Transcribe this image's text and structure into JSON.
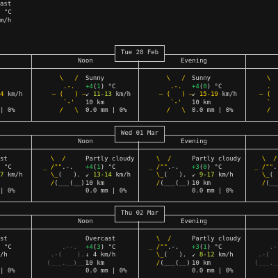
{
  "current": {
    "line1": "ast",
    "line2": "°C",
    "line3": "m/h"
  },
  "days": [
    {
      "date": "Tue 28 Feb",
      "periods": [
        {
          "label": ""
        },
        {
          "label": "Noon",
          "icon": "sun-icon",
          "desc": "Sunny",
          "temp_main": "+4",
          "temp_feel": "1",
          "temp_unit": "°C",
          "temp_color": "#2bd15c",
          "arrow": "↙",
          "wind": "11-13",
          "wind_unit": "km/h",
          "wind_color": "#c8e33a",
          "vis": "10 km",
          "precip": "0.0 mm",
          "chance": "0%"
        },
        {
          "label": "Evening",
          "icon": "sun-icon",
          "desc": "Sunny",
          "temp_main": "+4",
          "temp_feel": "0",
          "temp_unit": "°C",
          "temp_color": "#2bd15c",
          "arrow": "↙",
          "wind": "15-19",
          "wind_unit": "km/h",
          "wind_color": "#ffd400",
          "vis": "10 km",
          "precip": "0.0 mm",
          "chance": "0%"
        },
        {
          "label": ""
        }
      ],
      "left_partial": {
        "wind": "4 km/h",
        "chance": "| 0%"
      }
    },
    {
      "date": "Wed 01 Mar",
      "periods": [
        {
          "label": ""
        },
        {
          "label": "Noon",
          "icon": "partly-cloudy-icon",
          "desc": "Partly cloudy",
          "temp_main": "+4",
          "temp_feel": "1",
          "temp_unit": "°C",
          "temp_color": "#2bd15c",
          "arrow": "↙",
          "wind": "13-14",
          "wind_unit": "km/h",
          "wind_color": "#c8e33a",
          "vis": "10 km",
          "precip": "0.0 mm",
          "chance": "0%"
        },
        {
          "label": "Evening",
          "icon": "partly-cloudy-icon",
          "desc": "Partly cloudy",
          "temp_main": "+3",
          "temp_feel": "0",
          "temp_unit": "°C",
          "temp_color": "#2bd15c",
          "arrow": "↙",
          "wind": "9-17",
          "wind_unit": "km/h",
          "wind_color": "#c8e33a",
          "vis": "10 km",
          "precip": "0.0 mm",
          "chance": "0%"
        },
        {
          "label": ""
        }
      ],
      "left_partial": {
        "line1": "st",
        "line2": "°C",
        "wind": "7 km/h",
        "chance": "| 0%"
      }
    },
    {
      "date": "Thu 02 Mar",
      "periods": [
        {
          "label": ""
        },
        {
          "label": "Noon",
          "icon": "overcast-icon",
          "desc": "Overcast",
          "temp_main": "+4",
          "temp_feel": "3",
          "temp_unit": "°C",
          "temp_color": "#2bd15c",
          "arrow": "↓",
          "wind": "4",
          "wind_unit": "km/h",
          "wind_color": "#d6d6d6",
          "vis": "10 km",
          "precip": "0.0 mm",
          "chance": "0%"
        },
        {
          "label": "Evening",
          "icon": "partly-cloudy-icon",
          "desc": "Partly cloudy",
          "temp_main": "+3",
          "temp_feel": "1",
          "temp_unit": "°C",
          "temp_color": "#2bd15c",
          "arrow": "↙",
          "wind": "8-12",
          "wind_unit": "km/h",
          "wind_color": "#c8e33a",
          "vis": "10 km",
          "precip": "0.0 mm",
          "chance": "0%"
        },
        {
          "label": ""
        }
      ],
      "left_partial": {
        "line1": "st",
        "line2": "°C",
        "wind": "/h",
        "chance": "| 0%"
      }
    }
  ]
}
